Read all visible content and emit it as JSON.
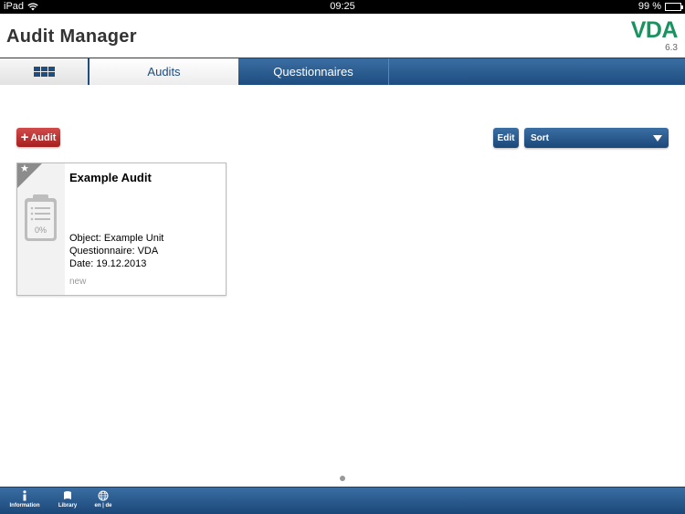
{
  "status_bar": {
    "device": "iPad",
    "time": "09:25",
    "battery": "99 %"
  },
  "header": {
    "title": "Audit Manager",
    "logo_text": "VDA",
    "version": "6.3"
  },
  "tabs": [
    {
      "label": "",
      "icon": "grid-icon"
    },
    {
      "label": "Audits"
    },
    {
      "label": "Questionnaires"
    }
  ],
  "toolbar": {
    "add_label": "Audit",
    "edit_label": "Edit",
    "sort_label": "Sort"
  },
  "audits": [
    {
      "title": "Example Audit",
      "progress": "0%",
      "object": "Object: Example Unit",
      "questionnaire": "Questionnaire: VDA",
      "date": "Date: 19.12.2013",
      "status": "new"
    }
  ],
  "bottom_bar": {
    "info": "Information",
    "library": "Library",
    "language": "en | de"
  },
  "colors": {
    "brand_blue": "#1e4d80",
    "logo_green": "#1a9360",
    "add_red": "#b82a2a"
  }
}
